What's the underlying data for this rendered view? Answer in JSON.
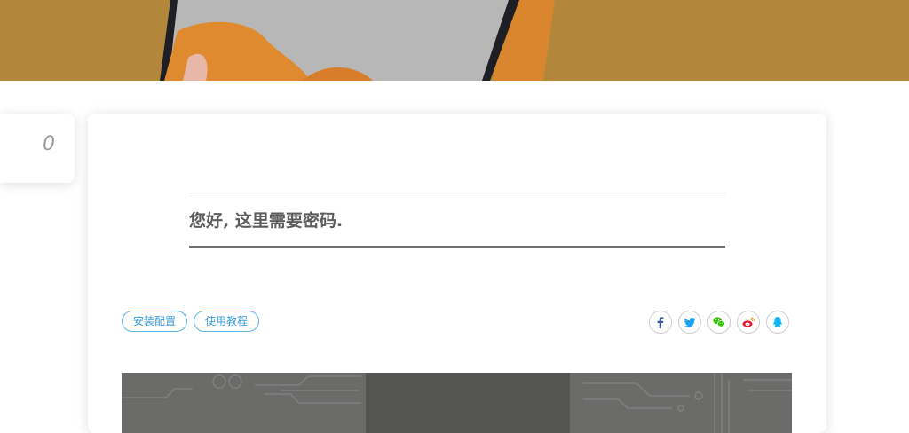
{
  "side_card": {
    "comment_count": "0"
  },
  "post": {
    "password_message": "您好, 这里需要密码."
  },
  "tags": [
    {
      "label": "安装配置"
    },
    {
      "label": "使用教程"
    }
  ],
  "share": [
    {
      "icon": "facebook-icon",
      "color": "#3b5998"
    },
    {
      "icon": "twitter-icon",
      "color": "#1da1f2"
    },
    {
      "icon": "wechat-icon",
      "color": "#2dc100"
    },
    {
      "icon": "weibo-icon",
      "color": "#e6162d"
    },
    {
      "icon": "qq-icon",
      "color": "#12b7f5"
    }
  ],
  "colors": {
    "hero_bg": "#b3873b",
    "tag_border": "#5bb3e6",
    "banner_bg": "#6b6b69"
  }
}
